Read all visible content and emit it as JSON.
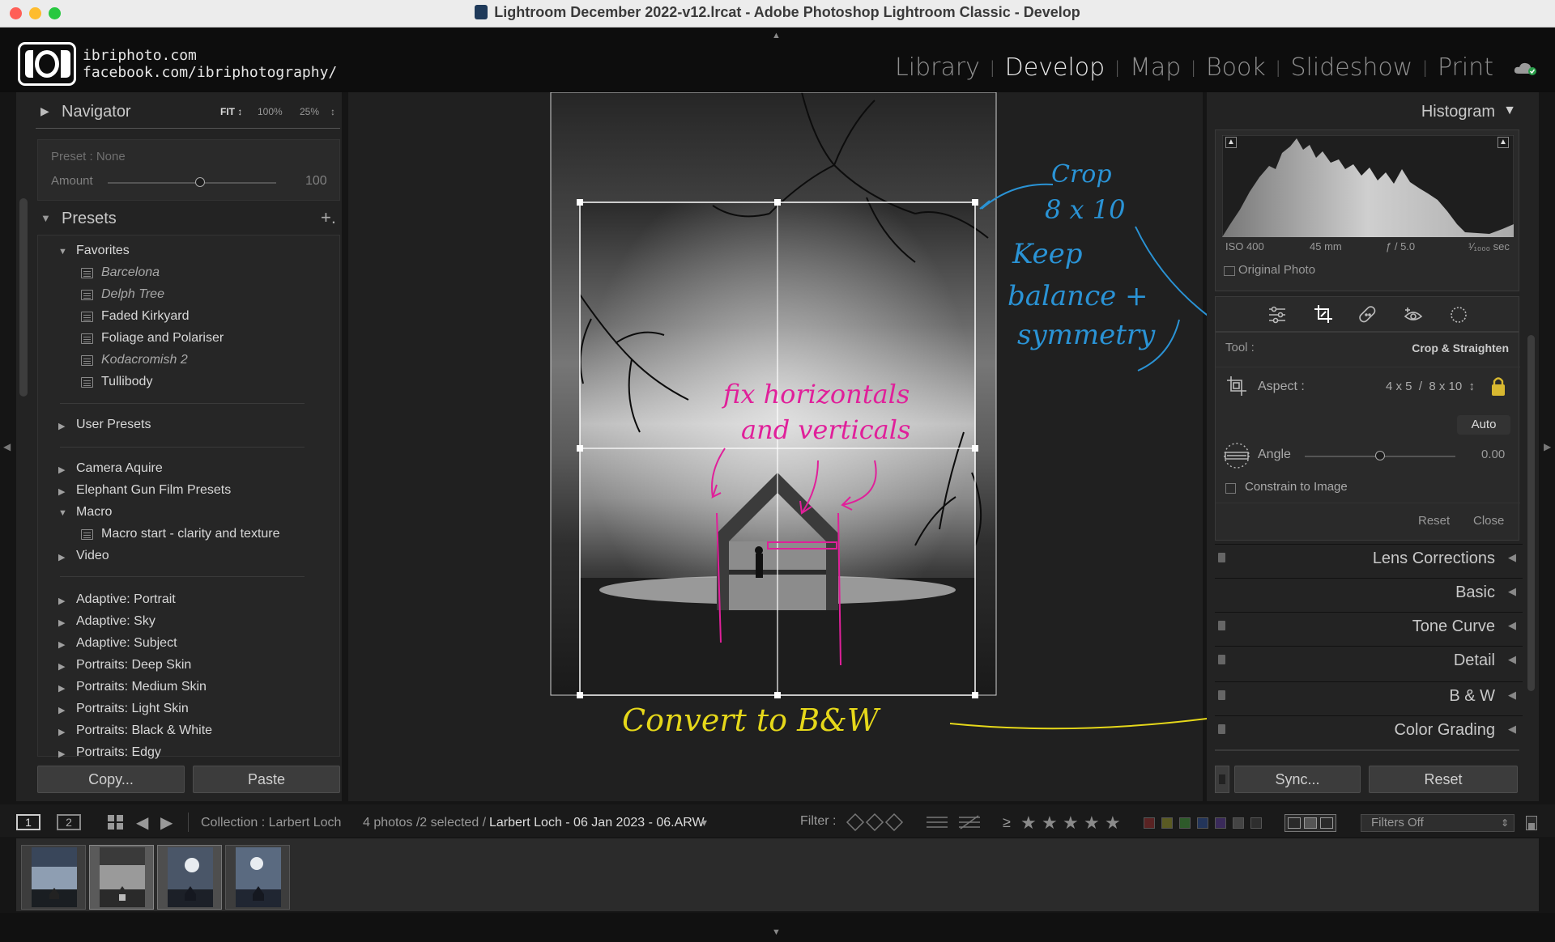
{
  "window": {
    "title": "Lightroom December 2022-v12.lrcat - Adobe Photoshop Lightroom Classic - Develop",
    "traffic_colors": [
      "#ff5f57",
      "#febc2e",
      "#28c840"
    ]
  },
  "identity_plate": {
    "line1": "ibriphoto.com",
    "line2": "facebook.com/ibriphotography/"
  },
  "modules": [
    {
      "label": "Library",
      "active": false
    },
    {
      "label": "Develop",
      "active": true
    },
    {
      "label": "Map",
      "active": false
    },
    {
      "label": "Book",
      "active": false
    },
    {
      "label": "Slideshow",
      "active": false
    },
    {
      "label": "Print",
      "active": false
    }
  ],
  "navigator": {
    "title": "Navigator",
    "zoom_fit": "FIT ↕",
    "zoom_100": "100%",
    "zoom_25": "25%",
    "zoom_arrow": "↕"
  },
  "preset_amount": {
    "preset_label": "Preset : None",
    "amount_label": "Amount",
    "amount_value": "100",
    "amount_level": 0.55
  },
  "presets": {
    "title": "Presets",
    "add": "+.",
    "favorites_label": "Favorites",
    "favorites": [
      {
        "name": "Barcelona",
        "italic": true
      },
      {
        "name": "Delph Tree",
        "italic": true
      },
      {
        "name": "Faded Kirkyard",
        "italic": false
      },
      {
        "name": "Foliage and Polariser",
        "italic": false
      },
      {
        "name": "Kodacromish 2",
        "italic": true
      },
      {
        "name": "Tullibody",
        "italic": false
      }
    ],
    "user_presets": "User Presets",
    "groups_a": [
      "Camera Aquire",
      "Elephant Gun Film Presets"
    ],
    "macro_label": "Macro",
    "macro_items": [
      "Macro start - clarity and texture"
    ],
    "video": "Video",
    "groups_b": [
      "Adaptive: Portrait",
      "Adaptive: Sky",
      "Adaptive: Subject",
      "Portraits: Deep Skin",
      "Portraits: Medium Skin",
      "Portraits: Light Skin",
      "Portraits: Black & White",
      "Portraits: Edgy"
    ]
  },
  "left_buttons": {
    "copy": "Copy...",
    "paste": "Paste"
  },
  "histogram": {
    "title": "Histogram",
    "iso": "ISO 400",
    "focal": "45 mm",
    "aperture": "ƒ / 5.0",
    "shutter": "¹⁄₁₀₀₀ sec",
    "original_photo": "Original Photo"
  },
  "crop_tool": {
    "tool_label": "Tool :",
    "tool_value": "Crop & Straighten",
    "aspect_label": "Aspect :",
    "aspect_value": "4 x 5  /  8 x 10  ↕",
    "auto": "Auto",
    "angle_label": "Angle",
    "angle_value": "0.00",
    "angle_level": 0.5,
    "constrain": "Constrain to Image",
    "reset": "Reset",
    "close": "Close"
  },
  "right_sections": [
    "Lens Corrections",
    "Basic",
    "Tone Curve",
    "Detail",
    "B & W",
    "Color Grading"
  ],
  "right_buttons": {
    "sync": "Sync...",
    "reset": "Reset"
  },
  "filmbar": {
    "view1": "1",
    "view2": "2",
    "collection": "Collection : Larbert Loch",
    "count": "4 photos /2 selected /",
    "filename": "Larbert Loch - 06 Jan 2023 - 06.ARW",
    "filename_arrow": "▾",
    "filter_label": "Filter :",
    "rating_op": "≥",
    "filters_off": "Filters Off",
    "label_colors": [
      "#5a2323",
      "#5a5a23",
      "#2e5a2a",
      "#23355a",
      "#3a2a5a",
      "#444444",
      "#2e2e2e"
    ]
  },
  "annotations": {
    "crop": "Crop",
    "ratio": "8 x 10",
    "keep": "Keep",
    "balance": "balance +",
    "symmetry": "symmetry",
    "fix1": "fix horizontals",
    "fix2": "and verticals",
    "convert": "Convert to B&W",
    "colors": {
      "blue": "#2a93d5",
      "magenta": "#e0209a",
      "yellow": "#e6d81a"
    }
  }
}
